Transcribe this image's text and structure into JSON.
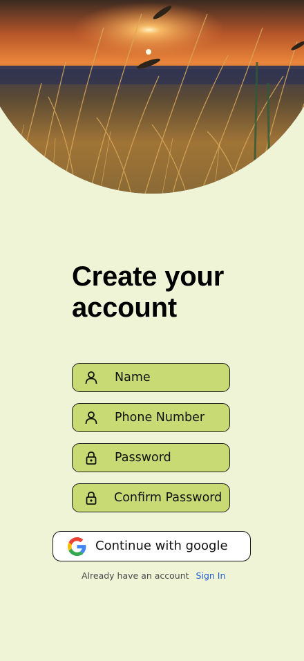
{
  "hero": {
    "image_description": "sunset-over-grass-field"
  },
  "title": {
    "line1": "Create your",
    "line2": "account"
  },
  "form": {
    "fields": [
      {
        "label": "Name",
        "icon": "user-icon"
      },
      {
        "label": "Phone Number",
        "icon": "user-icon"
      },
      {
        "label": "Password",
        "icon": "lock-icon"
      },
      {
        "label": "Confirm Password",
        "icon": "lock-icon"
      }
    ]
  },
  "google_button": {
    "label": "Continue with google",
    "icon": "google-icon"
  },
  "signin": {
    "prompt": "Already have an account",
    "link": "Sign In"
  },
  "colors": {
    "background": "#eff4d7",
    "field_fill": "#c8da74",
    "link": "#1f5fd0"
  }
}
